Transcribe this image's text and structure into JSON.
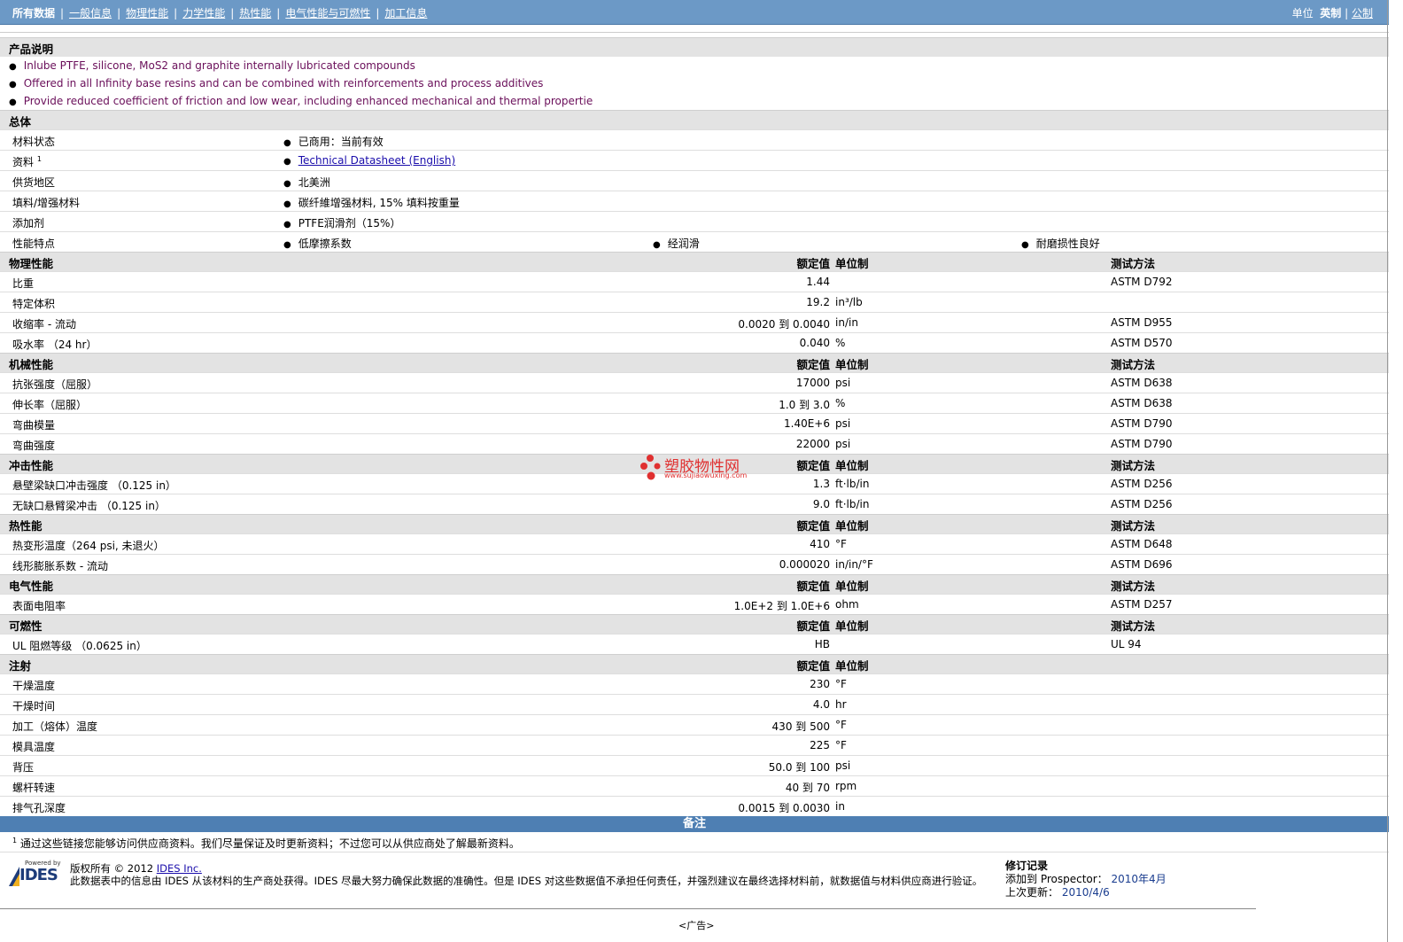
{
  "nav": {
    "items": [
      "所有数据",
      "一般信息",
      "物理性能",
      "力学性能",
      "热性能",
      "电气性能与可燃性",
      "加工信息"
    ],
    "units_label": "单位",
    "units_current": "英制",
    "units_alt": "公制"
  },
  "description": {
    "title": "产品说明",
    "bullets": [
      "Inlube PTFE, silicone, MoS2 and graphite internally lubricated compounds",
      "Offered in all Infinity base resins and can be combined with reinforcements and process additives",
      "Provide reduced coefficient of friction and low wear, including enhanced mechanical and thermal propertie"
    ]
  },
  "general": {
    "title": "总体",
    "rows": [
      {
        "name": "材料状态",
        "value": "已商用：当前有效"
      },
      {
        "name": "资料",
        "sup": "1",
        "value": "Technical Datasheet (English)"
      },
      {
        "name": "供货地区",
        "value": "北美洲"
      },
      {
        "name": "填料/增强材料",
        "value": "碳纤維增强材料, 15% 填料按重量"
      },
      {
        "name": "添加剂",
        "value": "PTFE润滑剂（15%）"
      }
    ],
    "features_name": "性能特点",
    "features": [
      "低摩擦系数",
      "经润滑",
      "耐磨损性良好"
    ]
  },
  "headers": {
    "value": "额定值",
    "unit": "单位制",
    "method": "测试方法"
  },
  "physical": {
    "title": "物理性能",
    "rows": [
      {
        "name": "比重",
        "value": "1.44",
        "unit": "",
        "method": "ASTM D792"
      },
      {
        "name": "特定体积",
        "value": "19.2",
        "unit": "in³/lb",
        "method": ""
      },
      {
        "name": "收缩率 - 流动",
        "value": "0.0020 到 0.0040",
        "unit": "in/in",
        "method": "ASTM D955"
      },
      {
        "name": "吸水率 （24 hr）",
        "value": "0.040",
        "unit": "%",
        "method": "ASTM D570"
      }
    ]
  },
  "mechanical": {
    "title": "机械性能",
    "rows": [
      {
        "name": "抗张强度（屈服）",
        "value": "17000",
        "unit": "psi",
        "method": "ASTM D638"
      },
      {
        "name": "伸长率（屈服）",
        "value": "1.0 到 3.0",
        "unit": "%",
        "method": "ASTM D638"
      },
      {
        "name": "弯曲模量",
        "value": "1.40E+6",
        "unit": "psi",
        "method": "ASTM D790"
      },
      {
        "name": "弯曲强度",
        "value": "22000",
        "unit": "psi",
        "method": "ASTM D790"
      }
    ]
  },
  "impact": {
    "title": "冲击性能",
    "rows": [
      {
        "name": "悬壁梁缺口冲击强度 （0.125 in）",
        "value": "1.3",
        "unit": "ft·lb/in",
        "method": "ASTM D256"
      },
      {
        "name": "无缺口悬臂梁冲击 （0.125 in）",
        "value": "9.0",
        "unit": "ft·lb/in",
        "method": "ASTM D256"
      }
    ]
  },
  "thermal": {
    "title": "热性能",
    "rows": [
      {
        "name": "热变形温度（264 psi, 未退火）",
        "value": "410",
        "unit": "°F",
        "method": "ASTM D648"
      },
      {
        "name": "线形膨胀系数 - 流动",
        "value": "0.000020",
        "unit": "in/in/°F",
        "method": "ASTM D696"
      }
    ]
  },
  "electrical": {
    "title": "电气性能",
    "rows": [
      {
        "name": "表面电阻率",
        "value": "1.0E+2 到 1.0E+6",
        "unit": "ohm",
        "method": "ASTM D257"
      }
    ]
  },
  "flammability": {
    "title": "可燃性",
    "rows": [
      {
        "name": "UL 阻燃等级 （0.0625 in）",
        "value": "HB",
        "unit": "",
        "method": "UL 94"
      }
    ]
  },
  "injection": {
    "title": "注射",
    "rows": [
      {
        "name": "干燥温度",
        "value": "230",
        "unit": "°F",
        "method": ""
      },
      {
        "name": "干燥时间",
        "value": "4.0",
        "unit": "hr",
        "method": ""
      },
      {
        "name": "加工（熔体）温度",
        "value": "430 到 500",
        "unit": "°F",
        "method": ""
      },
      {
        "name": "模具温度",
        "value": "225",
        "unit": "°F",
        "method": ""
      },
      {
        "name": "背压",
        "value": "50.0 到 100",
        "unit": "psi",
        "method": ""
      },
      {
        "name": "螺杆转速",
        "value": "40 到 70",
        "unit": "rpm",
        "method": ""
      },
      {
        "name": "排气孔深度",
        "value": "0.0015 到 0.0030",
        "unit": "in",
        "method": ""
      }
    ]
  },
  "notes": {
    "title": "备注",
    "sup": "1",
    "text": "通过这些链接您能够访问供应商资料。我们尽量保证及时更新资料；不过您可以从供应商处了解最新资料。"
  },
  "footer": {
    "powered_by": "Powered by",
    "logo_text": "IDES",
    "copyright_prefix": "版权所有 © 2012",
    "copyright_link": "IDES Inc.",
    "disclaimer": "此数据表中的信息由 IDES 从该材料的生产商处获得。IDES 尽最大努力确保此数据的准确性。但是 IDES 对这些数据值不承担任何责任，并强烈建议在最终选择材料前，就数据值与材料供应商进行验证。",
    "rev_title": "修订记录",
    "rev_added_label": "添加到 Prospector：",
    "rev_added_value": "2010年4月",
    "rev_updated_label": "上次更新：",
    "rev_updated_value": "2010/4/6",
    "ad": "<广告>"
  },
  "watermark": {
    "title": "塑胶物性网",
    "url": "www.sujiaowuxing.com"
  },
  "colors": {
    "topbar": "#6c99c6",
    "notes_bar": "#4e7fb3",
    "desc_text": "#6a0f5a",
    "watermark": "#e03030"
  }
}
